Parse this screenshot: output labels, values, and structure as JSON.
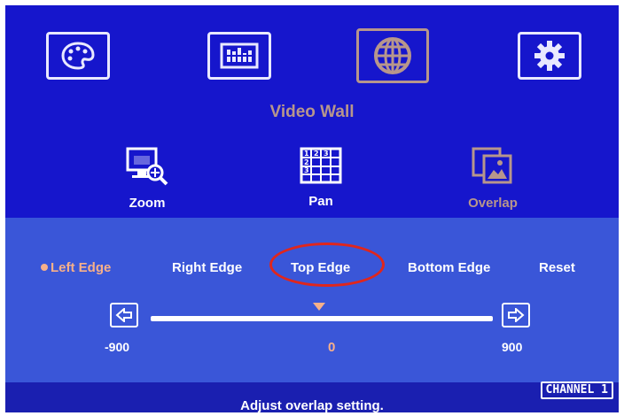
{
  "menu": {
    "title": "Video Wall",
    "tabs": [
      {
        "icon": "palette-icon"
      },
      {
        "icon": "sliders-icon"
      },
      {
        "icon": "globe-icon",
        "active": true
      },
      {
        "icon": "gear-icon"
      }
    ]
  },
  "submenu": {
    "items": [
      {
        "label": "Zoom",
        "icon": "zoom-icon"
      },
      {
        "label": "Pan",
        "icon": "pan-grid-icon"
      },
      {
        "label": "Overlap",
        "icon": "overlap-icon",
        "active": true
      }
    ]
  },
  "options": {
    "items": [
      "Left Edge",
      "Right Edge",
      "Top Edge",
      "Bottom Edge",
      "Reset"
    ],
    "selected": "Left Edge",
    "highlighted": "Top Edge"
  },
  "slider": {
    "min_label": "-900",
    "max_label": "900",
    "value_label": "0",
    "min": -900,
    "max": 900,
    "value": 0
  },
  "status": {
    "channel": "CHANNEL 1",
    "message": "Adjust overlap setting."
  },
  "colors": {
    "background": "#1616cc",
    "accent": "#b7968c",
    "selected": "#f7b08a",
    "annotation": "#e0261c"
  }
}
